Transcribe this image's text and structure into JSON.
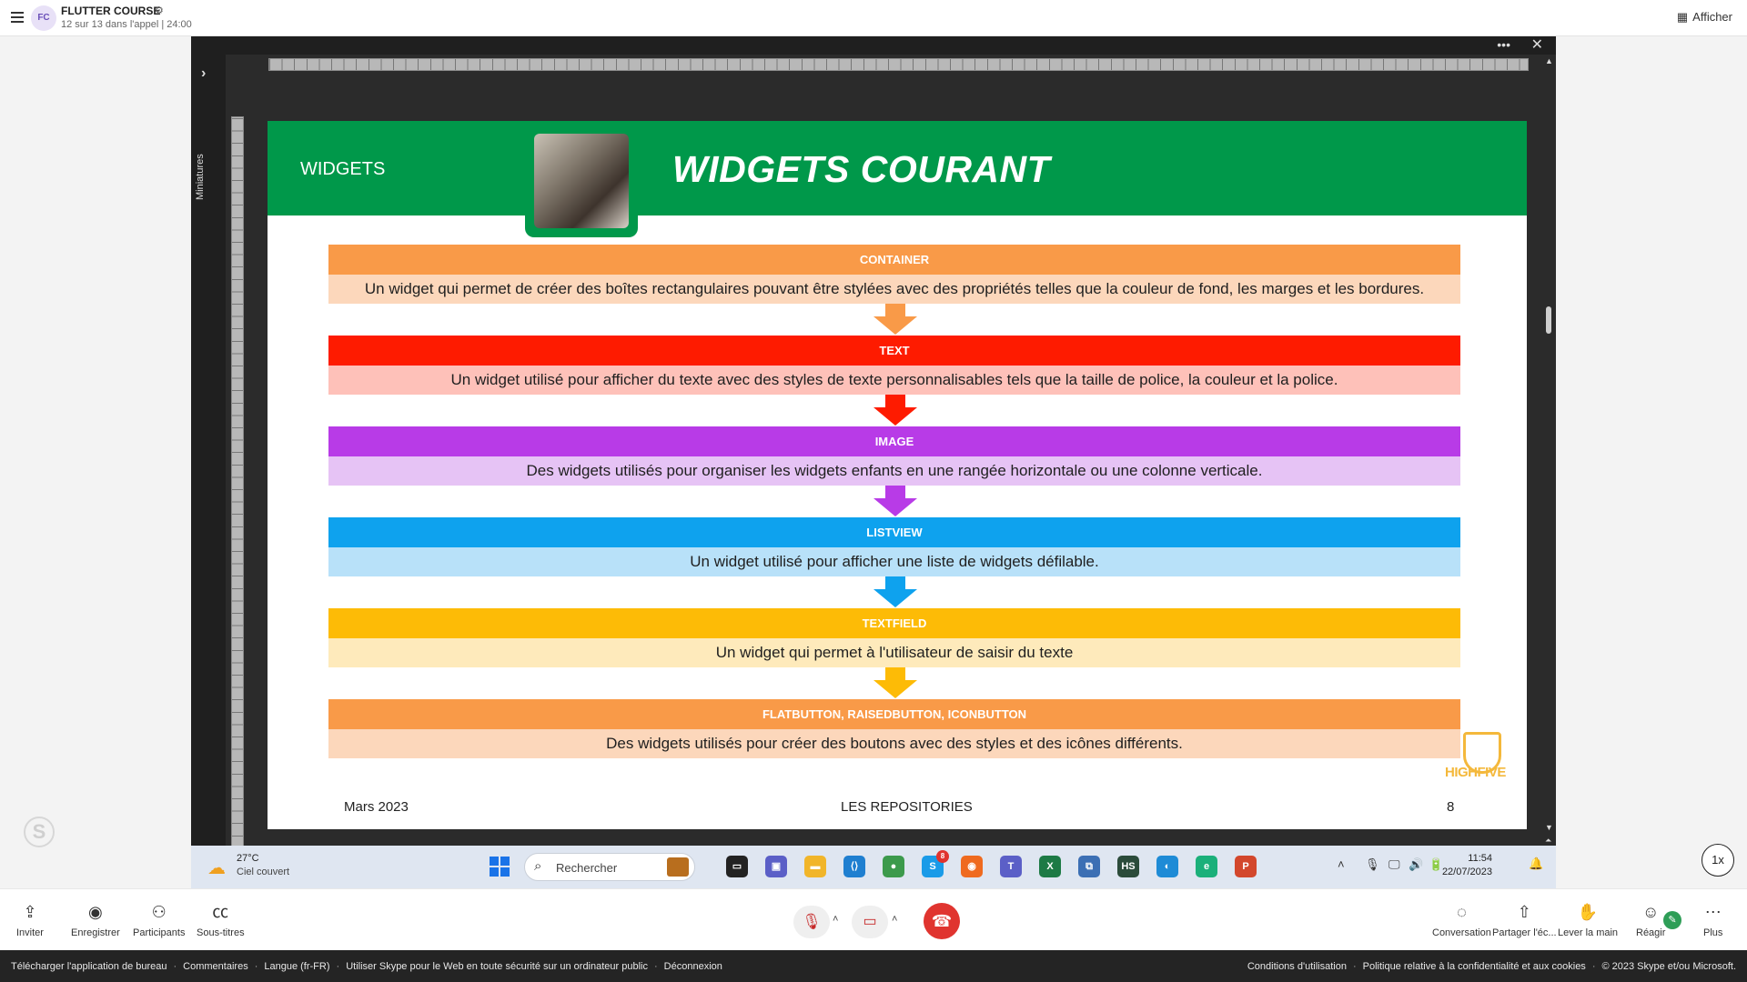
{
  "call": {
    "avatar_initials": "FC",
    "title": "FLUTTER COURSE",
    "subtitle": "12 sur 13 dans l'appel | 24:00",
    "afficher_label": "Afficher"
  },
  "powerpoint": {
    "thumbnails_label": "Miniatures"
  },
  "slide": {
    "section": "WIDGETS",
    "title": "WIDGETS COURANT",
    "date": "Mars 2023",
    "footer": "LES REPOSITORIES",
    "page_number": "8",
    "logo_text": "HIGHFIVE",
    "boxes": [
      {
        "title": "CONTAINER",
        "text": "Un widget qui permet de créer des boîtes rectangulaires pouvant être stylées avec des propriétés telles que la couleur de fond, les marges et les bordures.",
        "head_color": "#f99a48",
        "body_color": "#fcd7bb"
      },
      {
        "title": "TEXT",
        "text": "Un widget utilisé pour afficher du texte avec des styles de texte personnalisables tels que la taille de police, la couleur et la police.",
        "head_color": "#fe1b00",
        "body_color": "#fec1b9"
      },
      {
        "title": "IMAGE",
        "text": "Des widgets utilisés pour organiser les widgets enfants en une rangée horizontale ou une colonne verticale.",
        "head_color": "#b83be7",
        "body_color": "#e6c3f5"
      },
      {
        "title": "LISTVIEW",
        "text": "Un widget utilisé pour afficher une liste de widgets défilable.",
        "head_color": "#0ea2ee",
        "body_color": "#b8e1f9"
      },
      {
        "title": "TEXTFIELD",
        "text": "Un widget qui permet à l'utilisateur de saisir du texte",
        "head_color": "#fdbb06",
        "body_color": "#feeabb"
      },
      {
        "title": "FLATBUTTON, RAISEDBUTTON, ICONBUTTON",
        "text": "Des widgets utilisés pour créer des boutons avec des styles et des icônes différents.",
        "head_color": "#f99a48",
        "body_color": "#fcd7bb"
      }
    ]
  },
  "taskbar": {
    "weather_temp": "27°C",
    "weather_desc": "Ciel couvert",
    "search_placeholder": "Rechercher",
    "skype_badge": "8",
    "time": "11:54",
    "date": "22/07/2023",
    "apps": [
      {
        "name": "task-view",
        "color": "#222222",
        "glyph": "▭"
      },
      {
        "name": "teams-chat",
        "color": "#5b5fc7",
        "glyph": "▣"
      },
      {
        "name": "file-explorer",
        "color": "#f1b52a",
        "glyph": "▬"
      },
      {
        "name": "vscode",
        "color": "#1f7fd0",
        "glyph": "⟨⟩"
      },
      {
        "name": "chrome",
        "color": "#3c9a4c",
        "glyph": "●"
      },
      {
        "name": "skype",
        "color": "#1a9be8",
        "glyph": "S"
      },
      {
        "name": "firefox",
        "color": "#ef6a1f",
        "glyph": "◉"
      },
      {
        "name": "teams",
        "color": "#5b5fc7",
        "glyph": "T"
      },
      {
        "name": "excel",
        "color": "#1d7a45",
        "glyph": "X"
      },
      {
        "name": "remote-desktop",
        "color": "#3c6fb4",
        "glyph": "⧉"
      },
      {
        "name": "hs-app",
        "color": "#2b4b3a",
        "glyph": "HS"
      },
      {
        "name": "edge-dev",
        "color": "#1e8bd6",
        "glyph": "◐"
      },
      {
        "name": "edge",
        "color": "#1bb07a",
        "glyph": "e"
      },
      {
        "name": "powerpoint",
        "color": "#d3472c",
        "glyph": "P"
      }
    ]
  },
  "controls": {
    "left": [
      {
        "id": "invite",
        "label": "Inviter",
        "icon": "share-icon",
        "glyph": "⇪"
      },
      {
        "id": "record",
        "label": "Enregistrer",
        "icon": "record-icon",
        "glyph": "◉"
      },
      {
        "id": "participants",
        "label": "Participants",
        "icon": "people-icon",
        "glyph": "⚇"
      },
      {
        "id": "subtitles",
        "label": "Sous-titres",
        "icon": "cc-icon",
        "glyph": "㏄"
      }
    ],
    "right": [
      {
        "id": "conversation",
        "label": "Conversation",
        "icon": "chat-icon",
        "glyph": "◌"
      },
      {
        "id": "share-screen",
        "label": "Partager l'éc...",
        "icon": "share-screen-icon",
        "glyph": "⇧"
      },
      {
        "id": "raise-hand",
        "label": "Lever la main",
        "icon": "hand-icon",
        "glyph": "✋"
      },
      {
        "id": "react",
        "label": "Réagir",
        "icon": "react-icon",
        "glyph": "☺"
      },
      {
        "id": "more",
        "label": "Plus",
        "icon": "more-icon",
        "glyph": "⋯"
      }
    ],
    "speed": "1x"
  },
  "footer": {
    "left": [
      "Télécharger l'application de bureau",
      "Commentaires",
      "Langue (fr-FR)",
      "Utiliser Skype pour le Web en toute sécurité sur un ordinateur public",
      "Déconnexion"
    ],
    "right": [
      "Conditions d'utilisation",
      "Politique relative à la confidentialité et aux cookies",
      "© 2023 Skype et/ou Microsoft."
    ]
  }
}
